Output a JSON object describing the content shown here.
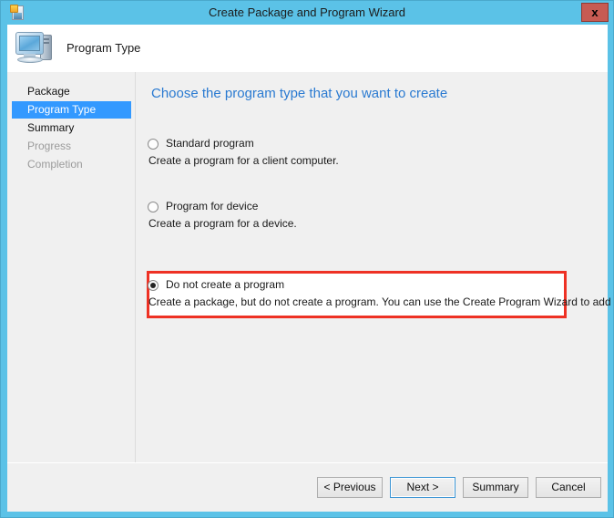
{
  "window": {
    "title": "Create Package and Program Wizard",
    "title_icon": "package-wizard-icon",
    "close_label": "x",
    "accent_color": "#5bc2e7",
    "close_color": "#c75b53"
  },
  "header": {
    "page_title": "Program Type",
    "icon": "computer-icon"
  },
  "sidebar": {
    "items": [
      {
        "label": "Package",
        "state": "done"
      },
      {
        "label": "Program Type",
        "state": "active"
      },
      {
        "label": "Summary",
        "state": "done"
      },
      {
        "label": "Progress",
        "state": "disabled"
      },
      {
        "label": "Completion",
        "state": "disabled"
      }
    ],
    "active_color": "#3399ff"
  },
  "content": {
    "heading": "Choose the program type that you want to create",
    "heading_color": "#2a7ad1",
    "options": [
      {
        "label": "Standard program",
        "description": "Create a program for a client computer.",
        "selected": false
      },
      {
        "label": "Program for device",
        "description": "Create a program for a device.",
        "selected": false
      },
      {
        "label": "Do not create a program",
        "description": "Create a package, but do not create a program. You can use the Create Program Wizard to add a program later.",
        "selected": true
      }
    ],
    "highlight_color": "#ee3124"
  },
  "footer": {
    "buttons": [
      {
        "label": "< Previous",
        "focused": false
      },
      {
        "label": "Next >",
        "focused": true
      },
      {
        "label": "Summary",
        "focused": false
      },
      {
        "label": "Cancel",
        "focused": false
      }
    ]
  }
}
